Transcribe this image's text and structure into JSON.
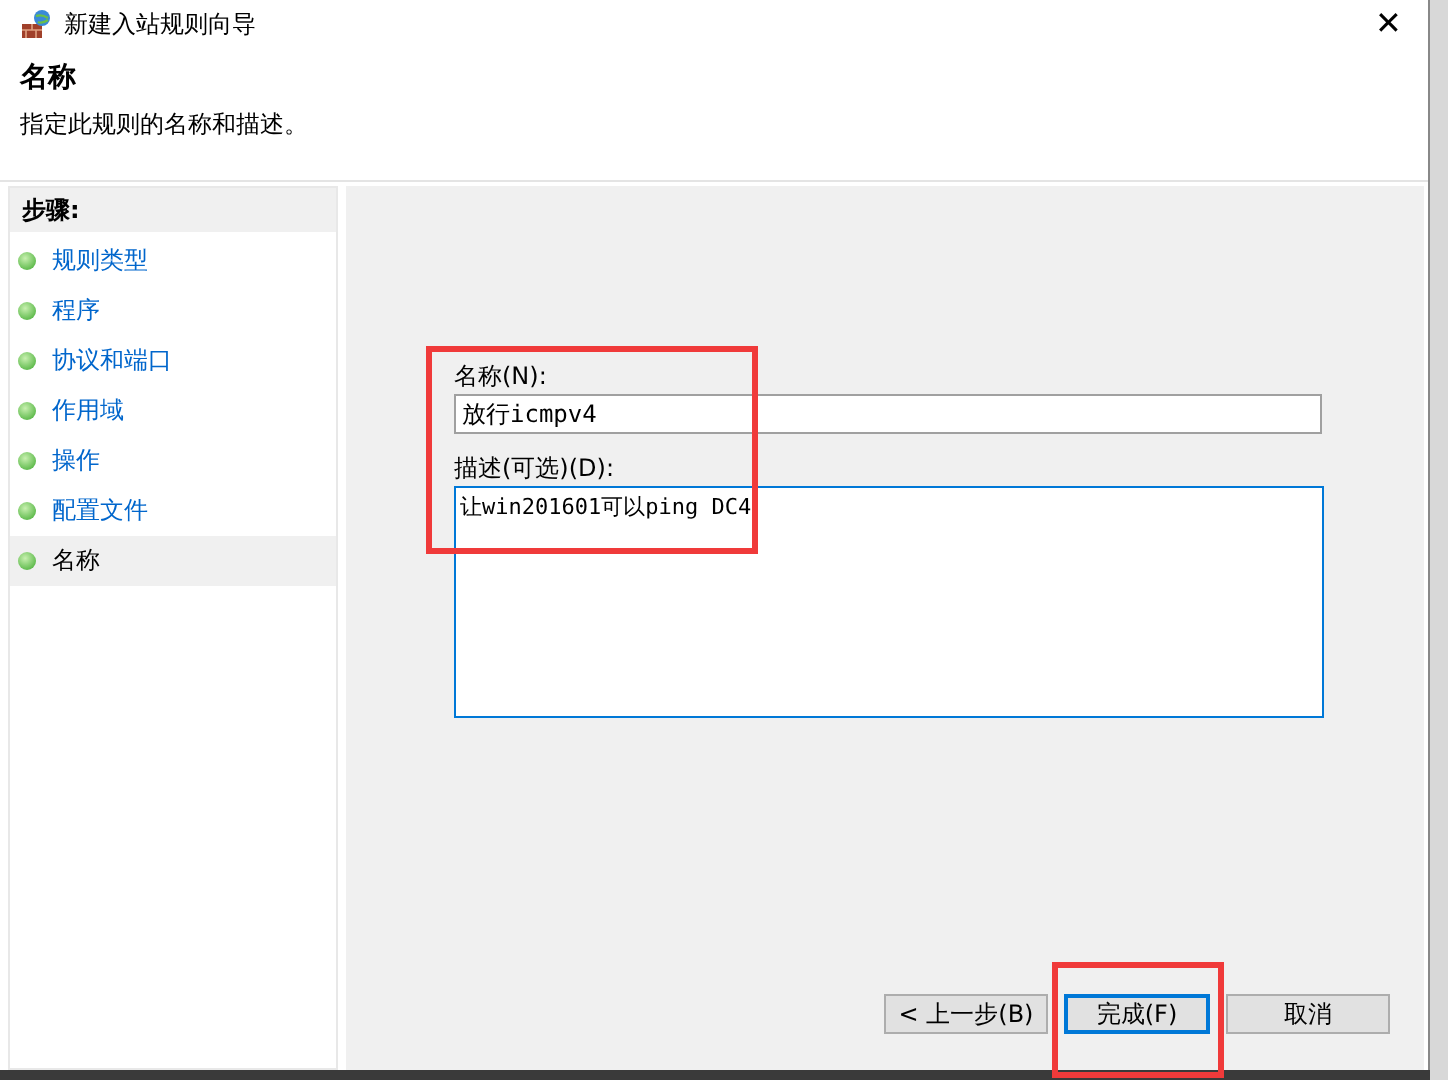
{
  "window": {
    "title": "新建入站规则向导",
    "close": "✕"
  },
  "header": {
    "title": "名称",
    "subtitle": "指定此规则的名称和描述。"
  },
  "steps": {
    "title": "步骤:",
    "items": [
      {
        "label": "规则类型",
        "selected": false
      },
      {
        "label": "程序",
        "selected": false
      },
      {
        "label": "协议和端口",
        "selected": false
      },
      {
        "label": "作用域",
        "selected": false
      },
      {
        "label": "操作",
        "selected": false
      },
      {
        "label": "配置文件",
        "selected": false
      },
      {
        "label": "名称",
        "selected": true
      }
    ]
  },
  "form": {
    "name_label": "名称(N):",
    "name_value": "放行icmpv4",
    "description_label": "描述(可选)(D):",
    "description_value": "让win201601可以ping DC4"
  },
  "buttons": [
    {
      "label": "< 上一步(B)",
      "default": false
    },
    {
      "label": "完成(F)",
      "default": true
    },
    {
      "label": "取消",
      "default": false
    }
  ]
}
